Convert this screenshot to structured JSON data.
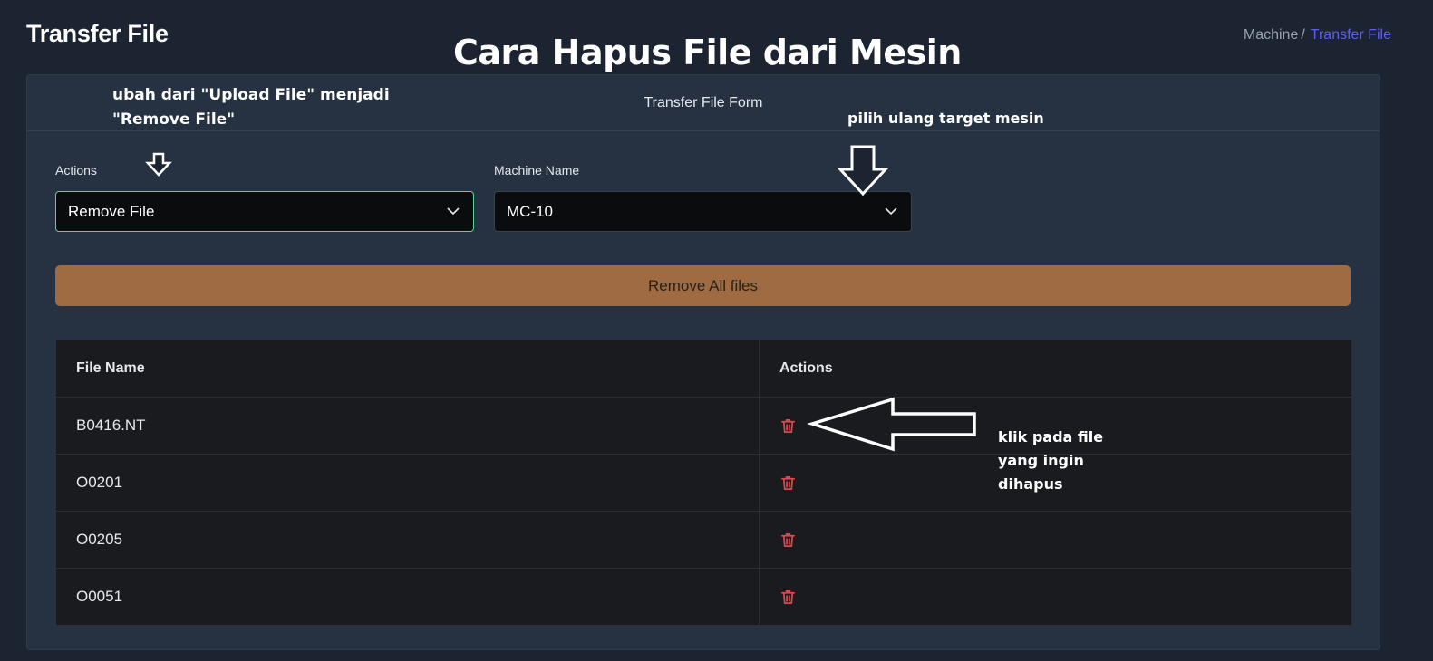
{
  "page": {
    "title": "Transfer File",
    "breadcrumb": {
      "parent": "Machine",
      "separator": "/",
      "current": "Transfer File"
    }
  },
  "card": {
    "header": "Transfer File Form"
  },
  "form": {
    "actions_label": "Actions",
    "actions_value": "Remove File",
    "machine_label": "Machine Name",
    "machine_value": "MC-10",
    "remove_all_label": "Remove All files"
  },
  "table": {
    "columns": [
      "File Name",
      "Actions"
    ],
    "rows": [
      {
        "file": "B0416.NT",
        "action_icon": "trash-icon"
      },
      {
        "file": "O0201",
        "action_icon": "trash-icon"
      },
      {
        "file": "O0205",
        "action_icon": "trash-icon"
      },
      {
        "file": "O0051",
        "action_icon": "trash-icon"
      }
    ]
  },
  "annotations": {
    "title": "Cara Hapus File dari Mesin",
    "note_actions_line1": "ubah dari \"Upload File\" menjadi",
    "note_actions_line2": "\"Remove File\"",
    "note_machine": "pilih ulang target mesin",
    "note_delete_line1": "klik pada file",
    "note_delete_line2": "yang ingin",
    "note_delete_line3": "dihapus"
  },
  "colors": {
    "background": "#1c2431",
    "card": "#263142",
    "accent_link": "#5b5ff0",
    "focus_border": "#5fd1a0",
    "remove_all_button": "#9e6b43",
    "trash_icon": "#e0484f"
  }
}
